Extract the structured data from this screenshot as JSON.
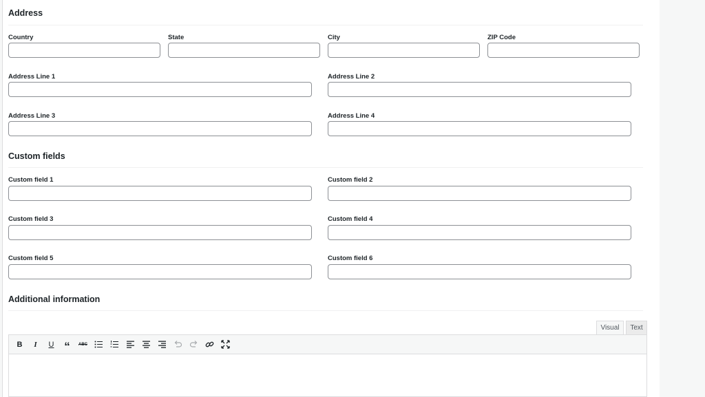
{
  "sections": {
    "address": "Address",
    "custom": "Custom fields",
    "additional": "Additional information"
  },
  "address": {
    "country": "Country",
    "state": "State",
    "city": "City",
    "zip": "ZIP Code",
    "line1": "Address Line 1",
    "line2": "Address Line 2",
    "line3": "Address Line 3",
    "line4": "Address Line 4"
  },
  "custom": {
    "f1": "Custom field 1",
    "f2": "Custom field 2",
    "f3": "Custom field 3",
    "f4": "Custom field 4",
    "f5": "Custom field 5",
    "f6": "Custom field 6"
  },
  "editor": {
    "tab_visual": "Visual",
    "tab_text": "Text",
    "toolbar_icons": [
      "bold-icon",
      "italic-icon",
      "underline-icon",
      "blockquote-icon",
      "strikethrough-icon",
      "bullet-list-icon",
      "numbered-list-icon",
      "align-left-icon",
      "align-center-icon",
      "align-right-icon",
      "undo-icon",
      "redo-icon",
      "link-icon",
      "fullscreen-icon"
    ],
    "bold_glyph": "B",
    "italic_glyph": "I",
    "underline_glyph": "U",
    "quote_glyph": "“",
    "strike_glyph": "ABC"
  },
  "colors": {
    "field_border": "#8c8f94",
    "background": "#f6f7f7",
    "text": "#1d2327"
  }
}
